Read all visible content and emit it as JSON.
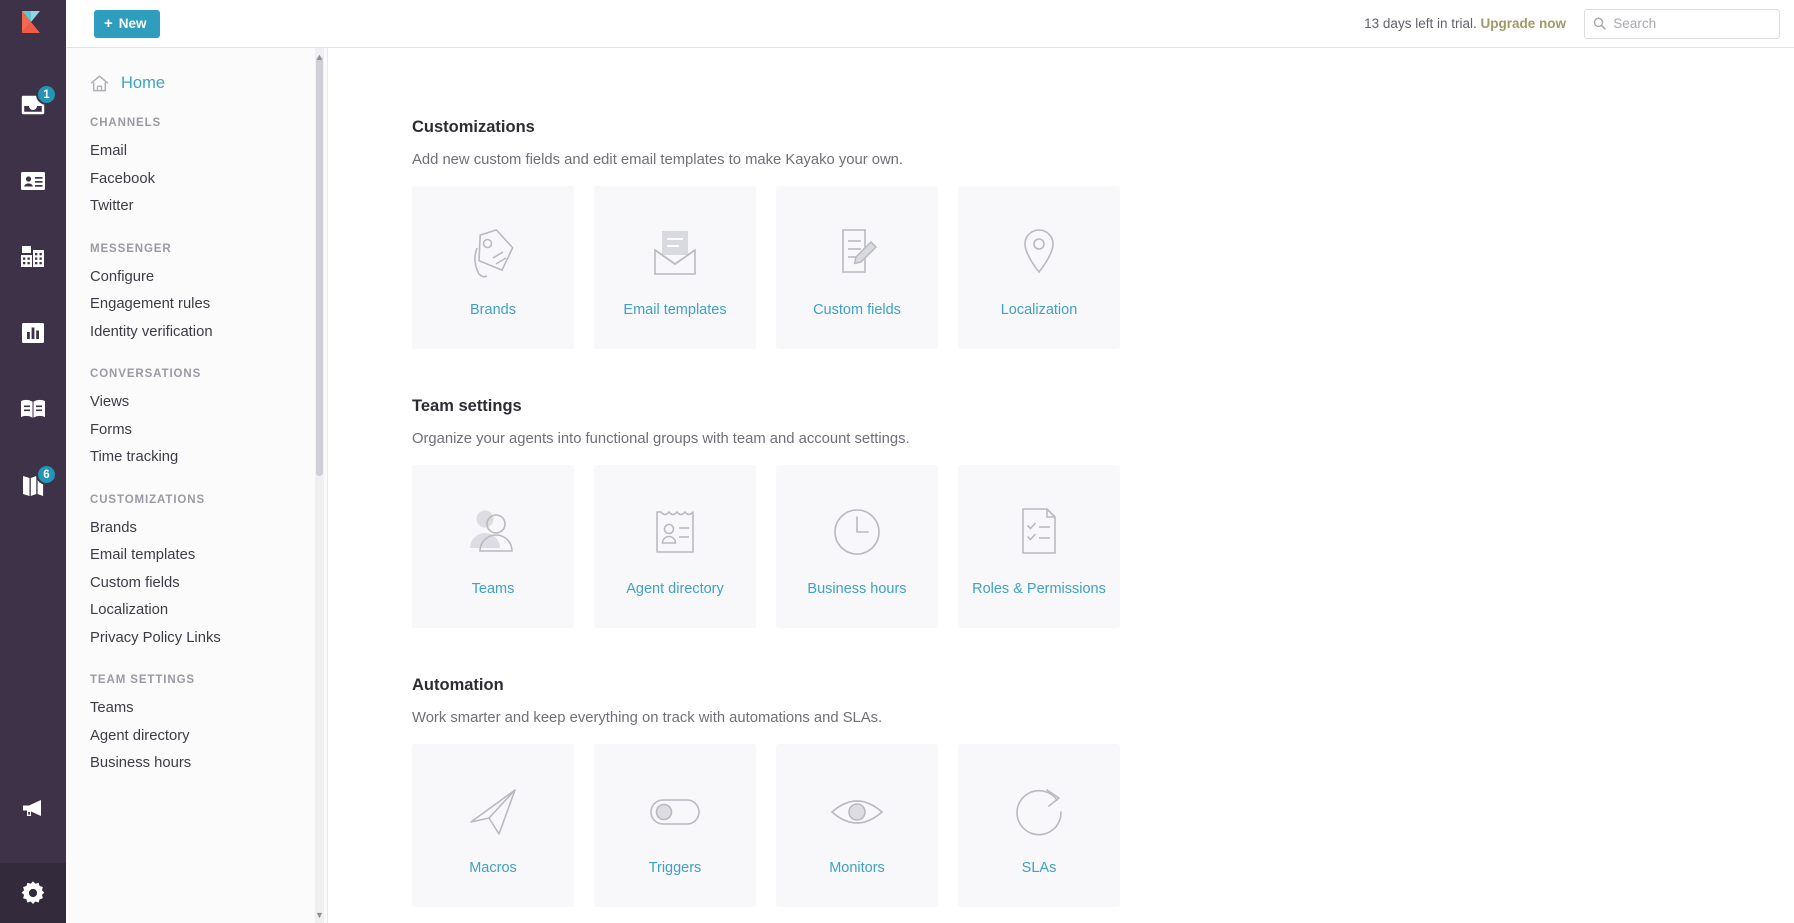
{
  "rail": {
    "logo": "kayako-logo",
    "items": [
      {
        "name": "inbox-icon",
        "badge": "1"
      },
      {
        "name": "contacts-icon",
        "badge": null
      },
      {
        "name": "organizations-icon",
        "badge": null
      },
      {
        "name": "reports-icon",
        "badge": null
      },
      {
        "name": "knowledgebase-icon",
        "badge": null
      },
      {
        "name": "insights-icon",
        "badge": "6"
      }
    ],
    "bottom_items": [
      {
        "name": "announcements-icon"
      },
      {
        "name": "gear-icon"
      }
    ],
    "colors": {
      "background": "#3d3247",
      "badge": "#2394b6",
      "active_background": "#332a3c"
    }
  },
  "topbar": {
    "new_label": "New",
    "new_plus": "+",
    "trial_prefix": "13 days left in trial.",
    "trial_cta": "Upgrade now",
    "search_placeholder": "Search",
    "search_value": "",
    "search_icon": "search-icon",
    "colors": {
      "new_button": "#2f9dbe",
      "upgrade": "#9c9b67"
    }
  },
  "nav": {
    "home_label": "Home",
    "home_icon": "home-icon",
    "sections": [
      {
        "title": "CHANNELS",
        "items": [
          "Email",
          "Facebook",
          "Twitter"
        ]
      },
      {
        "title": "MESSENGER",
        "items": [
          "Configure",
          "Engagement rules",
          "Identity verification"
        ]
      },
      {
        "title": "CONVERSATIONS",
        "items": [
          "Views",
          "Forms",
          "Time tracking"
        ]
      },
      {
        "title": "CUSTOMIZATIONS",
        "items": [
          "Brands",
          "Email templates",
          "Custom fields",
          "Localization",
          "Privacy Policy Links"
        ]
      },
      {
        "title": "TEAM SETTINGS",
        "items": [
          "Teams",
          "Agent directory",
          "Business hours"
        ]
      }
    ],
    "scroll_up": "▲",
    "scroll_down": "▼"
  },
  "main": {
    "sections": [
      {
        "title": "Customizations",
        "description": "Add new custom fields and edit email templates to make Kayako your own.",
        "cards": [
          {
            "label": "Brands",
            "icon": "tag-icon"
          },
          {
            "label": "Email templates",
            "icon": "open-envelope-icon"
          },
          {
            "label": "Custom fields",
            "icon": "document-pencil-icon"
          },
          {
            "label": "Localization",
            "icon": "map-pin-icon"
          }
        ]
      },
      {
        "title": "Team settings",
        "description": "Organize your agents into functional groups with team and account settings.",
        "cards": [
          {
            "label": "Teams",
            "icon": "people-icon"
          },
          {
            "label": "Agent directory",
            "icon": "id-card-icon"
          },
          {
            "label": "Business hours",
            "icon": "clock-icon"
          },
          {
            "label": "Roles & Permissions",
            "icon": "checklist-document-icon"
          }
        ]
      },
      {
        "title": "Automation",
        "description": "Work smarter and keep everything on track with automations and SLAs.",
        "cards": [
          {
            "label": "Macros",
            "icon": "paper-plane-icon"
          },
          {
            "label": "Triggers",
            "icon": "toggle-icon"
          },
          {
            "label": "Monitors",
            "icon": "eye-icon"
          },
          {
            "label": "SLAs",
            "icon": "refresh-clock-icon"
          }
        ]
      }
    ],
    "colors": {
      "card_background": "#f8f7fa",
      "link": "#3fa2c2",
      "heading": "#2c2c34",
      "description": "#6f6f79"
    }
  }
}
